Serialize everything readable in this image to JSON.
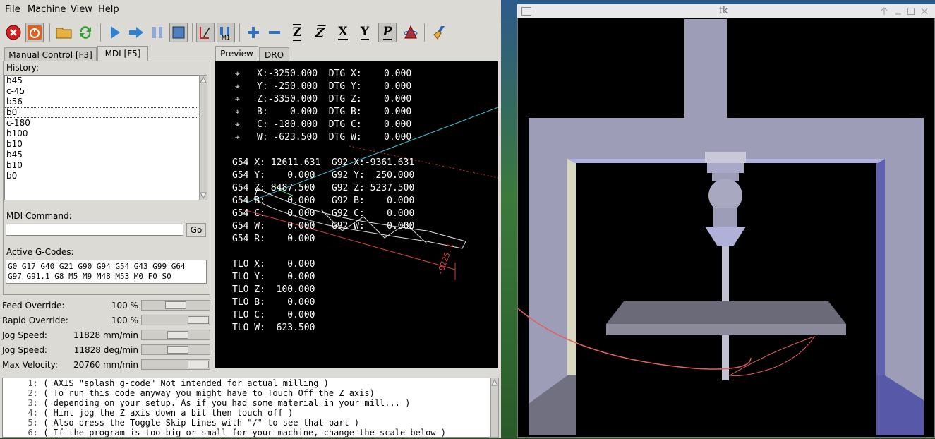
{
  "menubar": {
    "items": [
      "File",
      "Machine",
      "View",
      "Help"
    ]
  },
  "toolbar": {
    "icons": [
      "estop-icon",
      "power-icon",
      "open-icon",
      "reload-icon",
      "run-icon",
      "step-icon",
      "pause-icon",
      "block-delete-icon",
      "touch-off-icon",
      "optional-stop-icon",
      "zoom-in-icon",
      "zoom-out-icon",
      "view-z-icon",
      "view-rotated-z-icon",
      "view-x-icon",
      "view-y-icon",
      "view-p-icon",
      "rotate-icon",
      "clear-live-plot-icon"
    ],
    "letters": {
      "z": "Z",
      "z2": "Z",
      "x": "X",
      "y": "Y",
      "p": "P",
      "m1": "M1"
    }
  },
  "left_tabs": [
    "Manual Control [F3]",
    "MDI [F5]"
  ],
  "right_tabs": [
    "Preview",
    "DRO"
  ],
  "mdi": {
    "history_label": "History:",
    "history": [
      "b45",
      "c-45",
      "b56",
      "b0",
      "c-180",
      "b100",
      "b10",
      "b45",
      "b10",
      "b0"
    ],
    "selected_index": 3,
    "command_label": "MDI Command:",
    "command_value": "",
    "go_label": "Go",
    "active_label": "Active G-Codes:",
    "active_line1": "G0 G17 G40 G21 G90 G94 G54 G43 G99 G64",
    "active_line2": "G97 G91.1 G8 M5 M9 M48 M53 M0 F0 S0"
  },
  "sliders": [
    {
      "name": "Feed Override:",
      "value": "100 %",
      "level": 0.5
    },
    {
      "name": "Rapid Override:",
      "value": "100 %",
      "level": 1.0
    },
    {
      "name": "Jog Speed:",
      "value": "11828 mm/min",
      "level": 0.55
    },
    {
      "name": "Jog Speed:",
      "value": "11828 deg/min",
      "level": 0.55
    },
    {
      "name": "Max Velocity:",
      "value": "20760 mm/min",
      "level": 1.0
    }
  ],
  "dro": {
    "axes": [
      "X:-3250.000  DTG X:    0.000",
      "Y: -250.000  DTG Y:    0.000",
      "Z:-3350.000  DTG Z:    0.000",
      "B:    0.000  DTG B:    0.000",
      "C: -180.000  DTG C:    0.000",
      "W: -623.500  DTG W:    0.000"
    ],
    "offsets": [
      "G54 X: 12611.631  G92 X:-9361.631",
      "G54 Y:    0.000   G92 Y:  250.000",
      "G54 Z: 8487.500   G92 Z:-5237.500",
      "G54 B:    0.000   G92 B:    0.000",
      "G54 C:    0.000   G92 C:    0.000",
      "G54 W:    0.000   G92 W:    0.000",
      "G54 R:    0.000"
    ],
    "tlo": [
      "TLO X:    0.000",
      "TLO Y:    0.000",
      "TLO Z:  100.000",
      "TLO B:    0.000",
      "TLO C:    0.000",
      "TLO W:  623.500"
    ],
    "dimension_label": "-9225.1"
  },
  "gcode": {
    "lines": [
      {
        "n": "1:",
        "text": "( AXIS \"splash g-code\" Not intended for actual milling )"
      },
      {
        "n": "2:",
        "text": "( To run this code anyway you might have to Touch Off the Z axis)"
      },
      {
        "n": "3:",
        "text": "( depending on your setup. As if you had some material in your mill... )"
      },
      {
        "n": "4:",
        "text": "( Hint jog the Z axis down a bit then touch off )"
      },
      {
        "n": "5:",
        "text": "( Also press the Toggle Skip Lines with \"/\" to see that part )"
      },
      {
        "n": "6:",
        "text": "( If the program is too big or small for your machine, change the scale below )"
      }
    ]
  },
  "tk": {
    "title": "tk"
  },
  "colors": {
    "background": "#dcdad5",
    "preview_bg": "#000000",
    "machine": "#9a9ac0",
    "table": "#7a7a8a"
  }
}
